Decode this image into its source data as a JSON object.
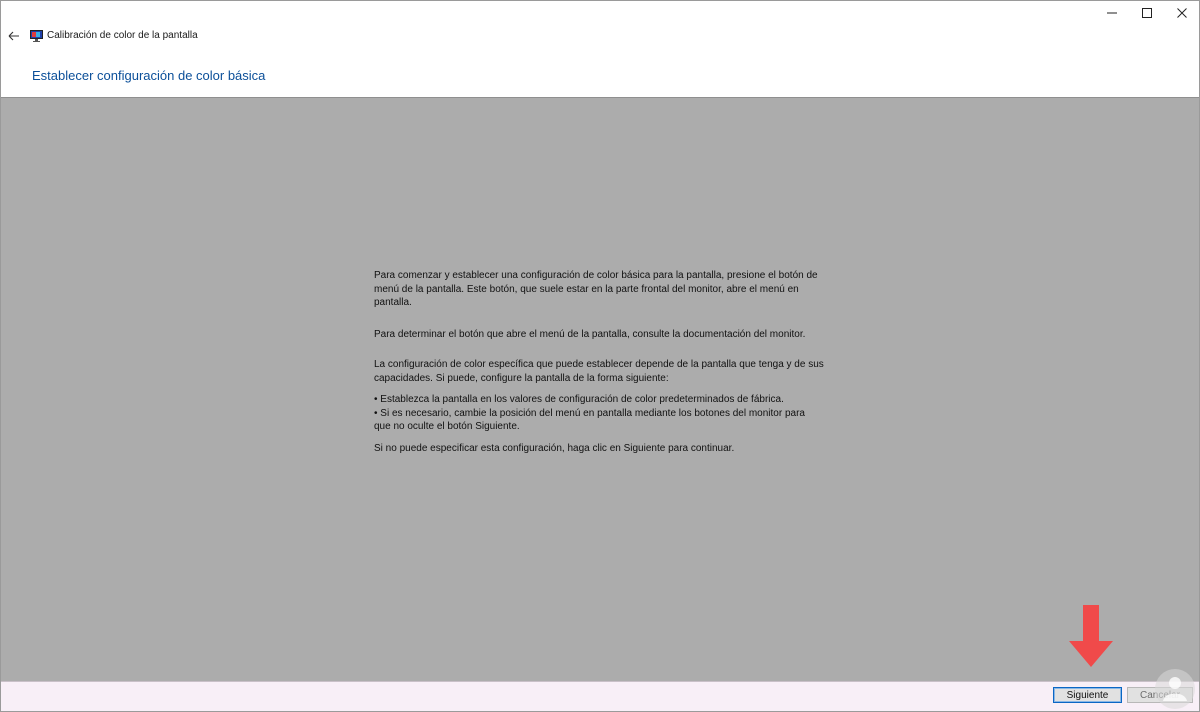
{
  "window": {
    "title": "Calibración de color de la pantalla",
    "controls": {
      "minimize": "minimize-icon",
      "maximize": "maximize-icon",
      "close": "close-icon"
    }
  },
  "page": {
    "heading": "Establecer configuración de color básica"
  },
  "body": {
    "p1": "Para comenzar y establecer una configuración de color básica para la pantalla, presione el botón de menú de la pantalla. Este botón, que suele estar en la parte frontal del monitor, abre el menú en pantalla.",
    "p2": "Para determinar el botón que abre el menú de la pantalla, consulte la documentación del monitor.",
    "p3": "La configuración de color específica que puede establecer depende de la pantalla que tenga y de sus capacidades. Si puede, configure la pantalla de la forma siguiente:",
    "bullet1": "• Establezca la pantalla en los valores de configuración de color predeterminados de fábrica.",
    "bullet2": "• Si es necesario, cambie la posición del menú en pantalla mediante los botones del monitor para que no oculte el botón Siguiente.",
    "p4": "Si no puede especificar esta configuración, haga clic en Siguiente para continuar."
  },
  "footer": {
    "next_label": "Siguiente",
    "cancel_label": "Cancelar"
  },
  "colors": {
    "heading": "#0b4f99",
    "content_bg": "#acacac",
    "footer_bg": "#f8eff7",
    "annotation_arrow": "#f04a4a"
  }
}
